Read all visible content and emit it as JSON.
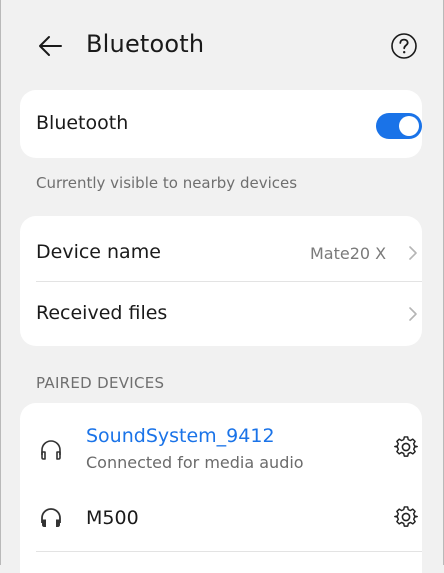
{
  "header": {
    "title": "Bluetooth",
    "back_icon": "arrow-left-icon",
    "help_icon": "question-circle-icon"
  },
  "bluetooth_toggle": {
    "label": "Bluetooth",
    "enabled": true,
    "accent": "#1a73e8"
  },
  "visibility_note": "Currently visible to nearby devices",
  "device_settings": {
    "device_name_label": "Device name",
    "device_name_value": "Mate20 X",
    "received_files_label": "Received files"
  },
  "paired": {
    "section_title": "PAIRED DEVICES",
    "devices": [
      {
        "name": "SoundSystem_9412",
        "status": "Connected for media audio",
        "connected": true,
        "icon": "headphones-outline-icon"
      },
      {
        "name": "M500",
        "status": "",
        "connected": false,
        "icon": "headphones-filled-icon"
      }
    ]
  }
}
